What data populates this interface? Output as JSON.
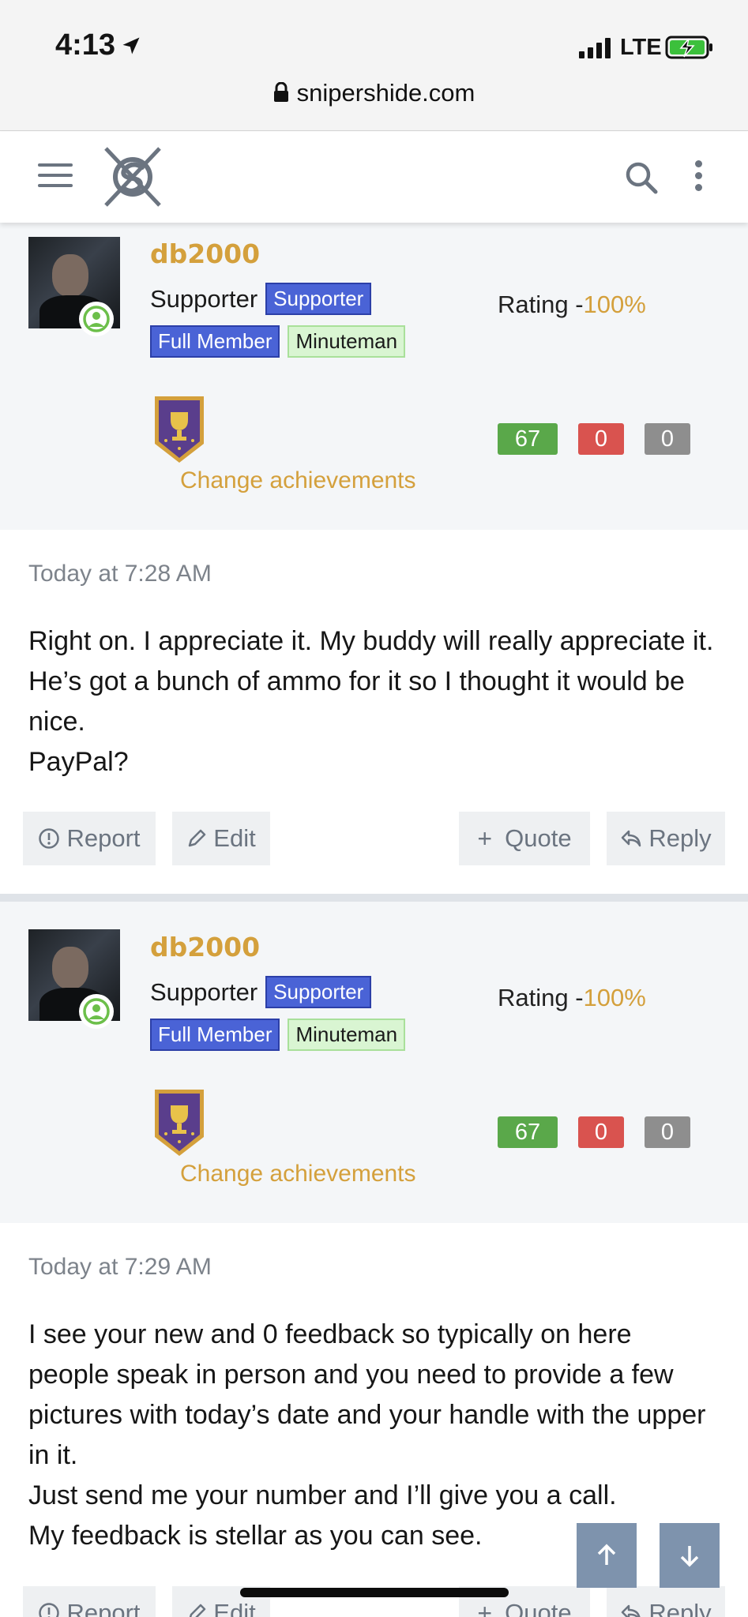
{
  "status": {
    "time": "4:13",
    "network": "LTE"
  },
  "browser": {
    "url": "snipershide.com"
  },
  "posts": [
    {
      "username": "db2000",
      "role": "Supporter",
      "badges": [
        "Supporter",
        "Full Member",
        "Minuteman"
      ],
      "rating_label": "Rating -",
      "rating_value": "100%",
      "change_achievements": "Change achievements",
      "feedback": {
        "positive": "67",
        "negative": "0",
        "neutral": "0"
      },
      "time": "Today at 7:28 AM",
      "message": [
        "Right on. I appreciate it. My buddy will really appreciate it. He’s got a bunch of ammo for it so I thought it would be nice.",
        "PayPal?"
      ],
      "actions": {
        "report": "Report",
        "edit": "Edit",
        "quote": "Quote",
        "reply": "Reply"
      }
    },
    {
      "username": "db2000",
      "role": "Supporter",
      "badges": [
        "Supporter",
        "Full Member",
        "Minuteman"
      ],
      "rating_label": "Rating -",
      "rating_value": "100%",
      "change_achievements": "Change achievements",
      "feedback": {
        "positive": "67",
        "negative": "0",
        "neutral": "0"
      },
      "time": "Today at 7:29 AM",
      "message": [
        "I see your new and 0 feedback so typically on here people speak in person and you need to provide a few pictures with today’s date and your handle with the upper in it.",
        "Just send me your number and I’ll give you a call.",
        "My feedback is stellar as you can see."
      ],
      "actions": {
        "report": "Report",
        "edit": "Edit",
        "quote": "Quote",
        "reply": "Reply"
      }
    }
  ],
  "colors": {
    "accent": "#d4a03c",
    "badge_blue": "#4a63d6",
    "badge_green": "#d9f5d2",
    "feedback_positive": "#5aa84a",
    "feedback_negative": "#d9534f",
    "feedback_neutral": "#8e8e8e",
    "scroll_button": "#7e93ad"
  },
  "icons": [
    "location-arrow-icon",
    "signal-icon",
    "battery-charging-icon",
    "lock-icon",
    "hamburger-menu-icon",
    "site-logo",
    "search-icon",
    "more-vertical-icon",
    "online-status-icon",
    "trophy-icon",
    "report-icon",
    "edit-icon",
    "quote-plus-icon",
    "reply-icon",
    "arrow-up-icon",
    "arrow-down-icon"
  ]
}
